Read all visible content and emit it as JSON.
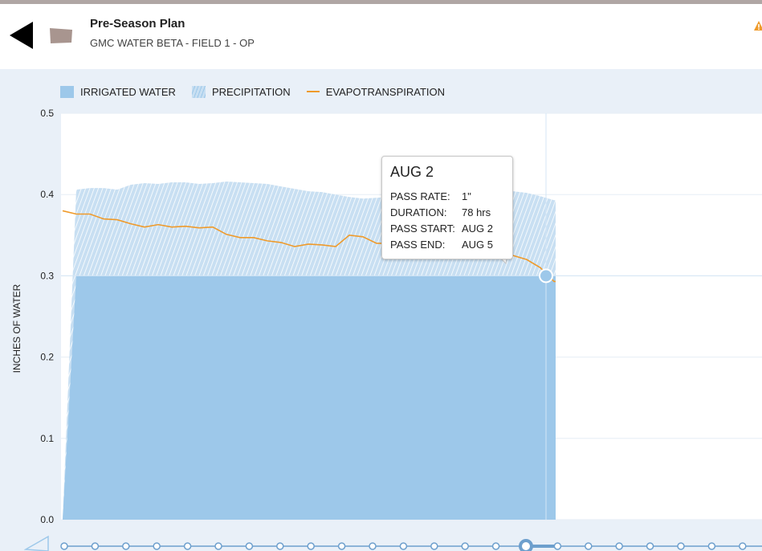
{
  "header": {
    "title": "Pre-Season Plan",
    "subtitle": "GMC WATER BETA - FIELD 1 - OP",
    "back_icon": "back-arrow-icon",
    "field_icon": "field-shape-icon",
    "warning_icon": "warning-icon"
  },
  "legend": {
    "irrigated": "IRRIGATED WATER",
    "precipitation": "PRECIPITATION",
    "et": "EVAPOTRANSPIRATION"
  },
  "tooltip": {
    "date": "AUG 2",
    "rows": [
      {
        "label": "PASS RATE:",
        "value": "1\""
      },
      {
        "label": "DURATION:",
        "value": "78 hrs"
      },
      {
        "label": "PASS START:",
        "value": "AUG 2"
      },
      {
        "label": "PASS END:",
        "value": "AUG 5"
      }
    ]
  },
  "colors": {
    "irrigated": "#9dc8ea",
    "precipitation": "#c8dff2",
    "et": "#ef9a2a",
    "panel": "#e9f0f8",
    "timeline": "#6d9fcd"
  },
  "chart_data": {
    "type": "area",
    "xlabel": "",
    "ylabel": "INCHES OF WATER",
    "ylim": [
      0,
      0.5
    ],
    "yticks": [
      "0.0",
      "0.1",
      "0.2",
      "0.3",
      "0.4",
      "0.5"
    ],
    "x_count": 49,
    "plotted_count": 37,
    "selected_index": 35,
    "series": [
      {
        "name": "IRRIGATED WATER",
        "kind": "area",
        "values": [
          0,
          0.3,
          0.3,
          0.3,
          0.3,
          0.3,
          0.3,
          0.3,
          0.3,
          0.3,
          0.3,
          0.3,
          0.3,
          0.3,
          0.3,
          0.3,
          0.3,
          0.3,
          0.3,
          0.3,
          0.3,
          0.3,
          0.3,
          0.3,
          0.3,
          0.3,
          0.3,
          0.3,
          0.3,
          0.3,
          0.3,
          0.3,
          0.3,
          0.3,
          0.3,
          0.3,
          0.3
        ]
      },
      {
        "name": "PRECIPITATION",
        "kind": "stacked-area",
        "values": [
          0,
          0.106,
          0.108,
          0.108,
          0.106,
          0.112,
          0.114,
          0.113,
          0.115,
          0.115,
          0.113,
          0.114,
          0.116,
          0.115,
          0.114,
          0.113,
          0.11,
          0.107,
          0.104,
          0.103,
          0.1,
          0.097,
          0.095,
          0.096,
          0.097,
          0.098,
          0.099,
          0.1,
          0.101,
          0.102,
          0.103,
          0.104,
          0.104,
          0.104,
          0.102,
          0.098,
          0.093
        ]
      },
      {
        "name": "EVAPOTRANSPIRATION",
        "kind": "line",
        "values": [
          0.38,
          0.376,
          0.376,
          0.37,
          0.369,
          0.364,
          0.36,
          0.363,
          0.36,
          0.361,
          0.359,
          0.36,
          0.351,
          0.347,
          0.347,
          0.343,
          0.341,
          0.336,
          0.339,
          0.338,
          0.336,
          0.35,
          0.348,
          0.34,
          0.34,
          0.343,
          0.345,
          0.345,
          0.343,
          0.343,
          0.34,
          0.335,
          0.33,
          0.325,
          0.32,
          0.31,
          0.293
        ]
      }
    ]
  }
}
